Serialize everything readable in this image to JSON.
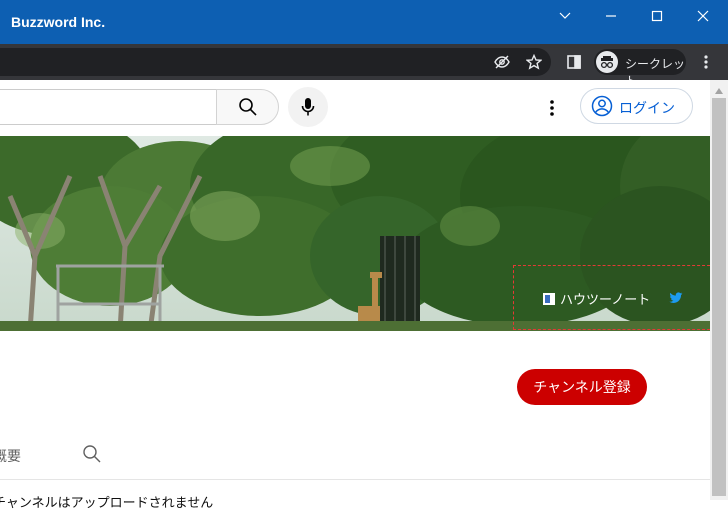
{
  "window": {
    "title": "Buzzword Inc."
  },
  "browser": {
    "incognito_label": "シークレット"
  },
  "header": {
    "login_label": "ログイン"
  },
  "banner": {
    "link_howto": "ハウツーノート"
  },
  "channel": {
    "subscribe_label": "チャンネル登録"
  },
  "tabs": {
    "about_label": "概要"
  },
  "description": {
    "text": "チャンネルはアップロードされません"
  },
  "colors": {
    "titlebar": "#0d5fb2",
    "subscribe": "#cc0000",
    "login": "#065fd4",
    "twitter": "#1d9bf0",
    "highlight": "#e53935"
  },
  "icons": [
    "chevron-down-icon",
    "minimize-icon",
    "maximize-icon",
    "close-icon",
    "eye-off-icon",
    "star-icon",
    "side-panel-icon",
    "incognito-icon",
    "more-vert-icon",
    "search-icon",
    "mic-icon",
    "account-icon",
    "twitter-icon"
  ]
}
